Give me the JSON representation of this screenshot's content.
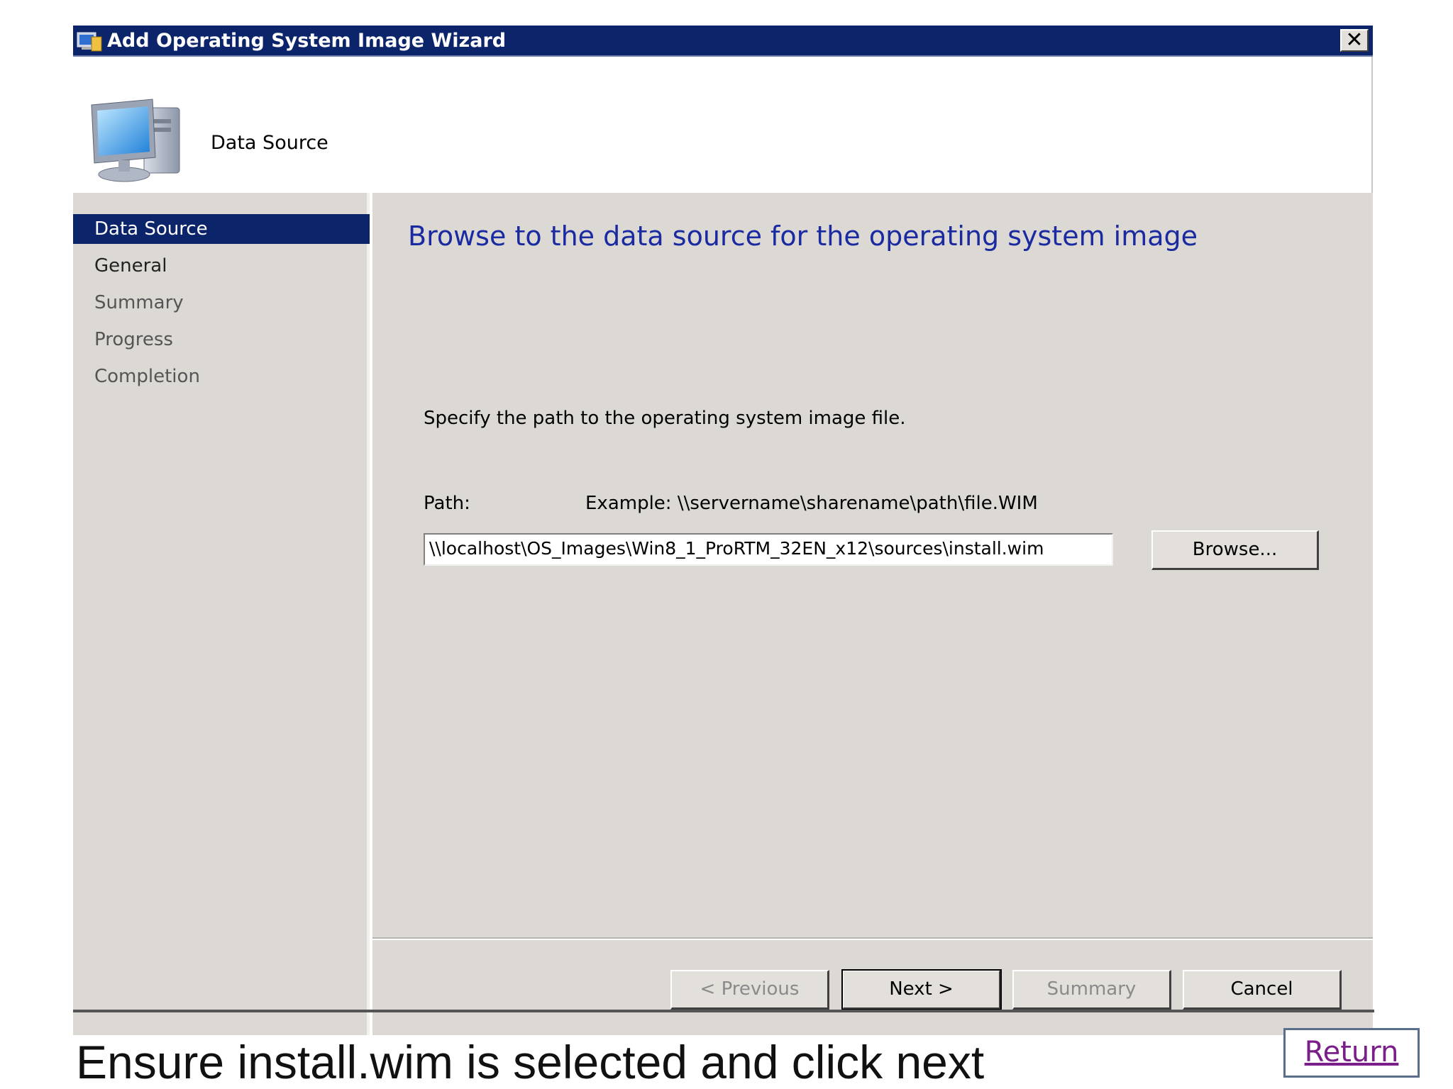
{
  "window": {
    "title": "Add Operating System Image Wizard",
    "close_label": "✕"
  },
  "header": {
    "title": "Data Source"
  },
  "nav": {
    "items": [
      {
        "label": "Data Source",
        "state": "active"
      },
      {
        "label": "General",
        "state": "normal"
      },
      {
        "label": "Summary",
        "state": "muted"
      },
      {
        "label": "Progress",
        "state": "muted"
      },
      {
        "label": "Completion",
        "state": "muted"
      }
    ]
  },
  "main": {
    "heading": "Browse to the data source for the operating system image",
    "instruction": "Specify the path to the operating system image file.",
    "path_label": "Path:",
    "example": "Example:  \\\\servername\\sharename\\path\\file.WIM",
    "path_value": "\\\\localhost\\OS_Images\\Win8_1_ProRTM_32EN_x12\\sources\\install.wim",
    "browse_label": "Browse..."
  },
  "footer_buttons": {
    "previous": "< Previous",
    "next": "Next >",
    "summary": "Summary",
    "cancel": "Cancel"
  },
  "slide": {
    "caption": "Ensure install.wim is selected and click next",
    "return_label": "Return"
  },
  "colors": {
    "titlebar": "#0b246a",
    "panel": "#dcd8d4",
    "heading": "#1a2aa0",
    "return_link": "#7a1e8a"
  }
}
